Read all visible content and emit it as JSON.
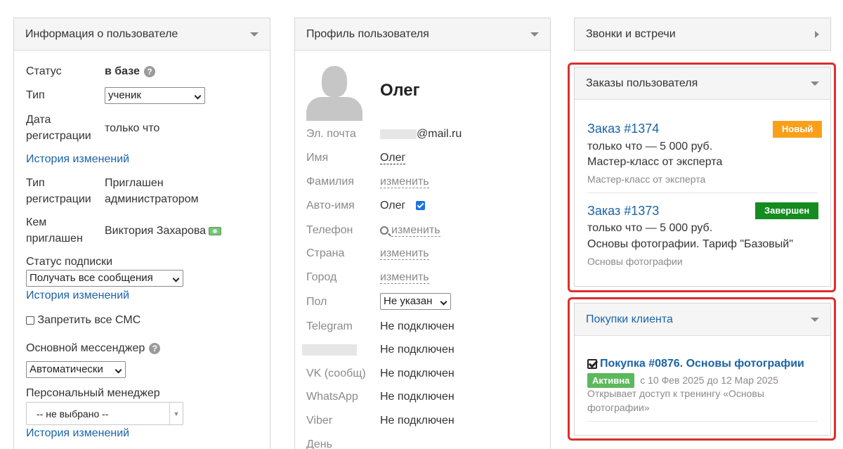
{
  "colors": {
    "link": "#1a63a8",
    "badge_new": "#f9a01b",
    "badge_done": "#148c1f",
    "badge_active": "#5cb85c",
    "highlight": "#d9302c"
  },
  "user_info": {
    "title": "Информация о пользователе",
    "status_label": "Статус",
    "status_value": "в базе",
    "type_label": "Тип",
    "type_value": "ученик",
    "reg_date_label_1": "Дата",
    "reg_date_label_2": "регистрации",
    "reg_date_value": "только что",
    "history_link": "История изменений",
    "reg_type_label_1": "Тип",
    "reg_type_label_2": "регистрации",
    "reg_type_value_1": "Приглашен",
    "reg_type_value_2": "администратором",
    "invited_by_label_1": "Кем",
    "invited_by_label_2": "приглашен",
    "invited_by_value": "Виктория Захарова",
    "subscription_label": "Статус подписки",
    "subscription_value": "Получать все сообщения",
    "history_link_2": "История изменений",
    "ban_sms_label": "Запретить все СМС",
    "messenger_label": "Основной мессенджер",
    "messenger_value": "Автоматически",
    "manager_label": "Персональный менеджер",
    "manager_value": "-- не выбрано --",
    "history_link_3": "История изменений"
  },
  "profile": {
    "title": "Профиль пользователя",
    "name": "Олег",
    "fields": {
      "email_label": "Эл. почта",
      "email_value": "@mail.ru",
      "first_name_label": "Имя",
      "first_name_value": "Олег",
      "last_name_label": "Фамилия",
      "last_name_value": "изменить",
      "autoname_label": "Авто-имя",
      "autoname_value": "Олег",
      "phone_label": "Телефон",
      "phone_value": "изменить",
      "country_label": "Страна",
      "country_value": "изменить",
      "city_label": "Город",
      "city_value": "изменить",
      "gender_label": "Пол",
      "gender_value": "Не указан",
      "telegram_label": "Telegram",
      "telegram_value": "Не подключен",
      "hidden_value": "Не подключен",
      "vk_label": "VK (сообщ)",
      "vk_value": "Не подключен",
      "whatsapp_label": "WhatsApp",
      "whatsapp_value": "Не подключен",
      "viber_label": "Viber",
      "viber_value": "Не подключен",
      "day_label": "День"
    }
  },
  "calls": {
    "title": "Звонки и встречи"
  },
  "orders": {
    "title": "Заказы пользователя",
    "items": [
      {
        "title": "Заказ #1374",
        "badge": "Новый",
        "line1": "только что — 5 000 руб.",
        "line2": "Мастер-класс от эксперта",
        "line3": "Мастер-класс от эксперта"
      },
      {
        "title": "Заказ #1373",
        "badge": "Завершен",
        "line1": "только что — 5 000 руб.",
        "line2": "Основы фотографии. Тариф \"Базовый\"",
        "line3": "Основы фотографии"
      }
    ]
  },
  "purchases": {
    "title": "Покупки клиента",
    "item": {
      "title": "Покупка #0876. Основы фотографии",
      "badge": "Активна",
      "dates": "с 10 Фев 2025 до 12 Мар 2025",
      "desc_1": "Открывает доступ к тренингу «Основы",
      "desc_2": "фотографии»"
    }
  }
}
